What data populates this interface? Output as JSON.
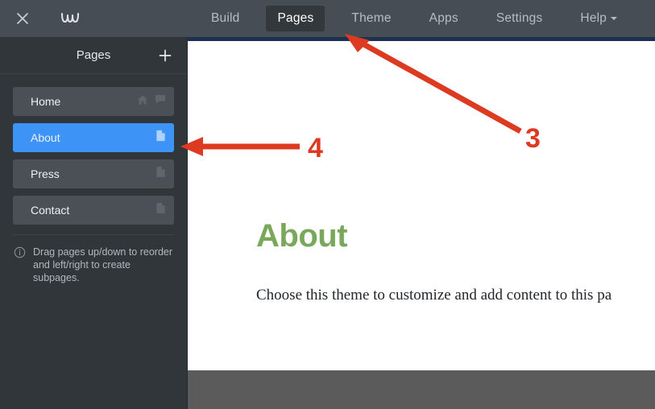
{
  "topbar": {
    "close_icon": "close-icon",
    "logo_icon": "weebly-logo-icon",
    "nav": [
      {
        "label": "Build",
        "active": false,
        "caret": false
      },
      {
        "label": "Pages",
        "active": true,
        "caret": false
      },
      {
        "label": "Theme",
        "active": false,
        "caret": false
      },
      {
        "label": "Apps",
        "active": false,
        "caret": false
      },
      {
        "label": "Settings",
        "active": false,
        "caret": false
      },
      {
        "label": "Help",
        "active": false,
        "caret": true
      }
    ]
  },
  "sidebar": {
    "title": "Pages",
    "add_icon": "plus-icon",
    "pages": [
      {
        "label": "Home",
        "selected": false,
        "icons": [
          "home-icon",
          "speech-bubble-icon"
        ]
      },
      {
        "label": "About",
        "selected": true,
        "icons": [
          "document-icon"
        ]
      },
      {
        "label": "Press",
        "selected": false,
        "icons": [
          "document-icon"
        ]
      },
      {
        "label": "Contact",
        "selected": false,
        "icons": [
          "document-icon"
        ]
      }
    ],
    "hint_icon": "info-icon",
    "hint_line1": "Drag pages up/down to reorder",
    "hint_line2": "and left/right to create subpages."
  },
  "content": {
    "heading": "About",
    "body": "Choose this theme to customize and add content to this pa",
    "heading_color": "#7aa85a"
  },
  "annotations": {
    "color": "#dd3a22",
    "items": [
      {
        "number": "3",
        "target": "pages-tab"
      },
      {
        "number": "4",
        "target": "about-page-row"
      }
    ]
  }
}
